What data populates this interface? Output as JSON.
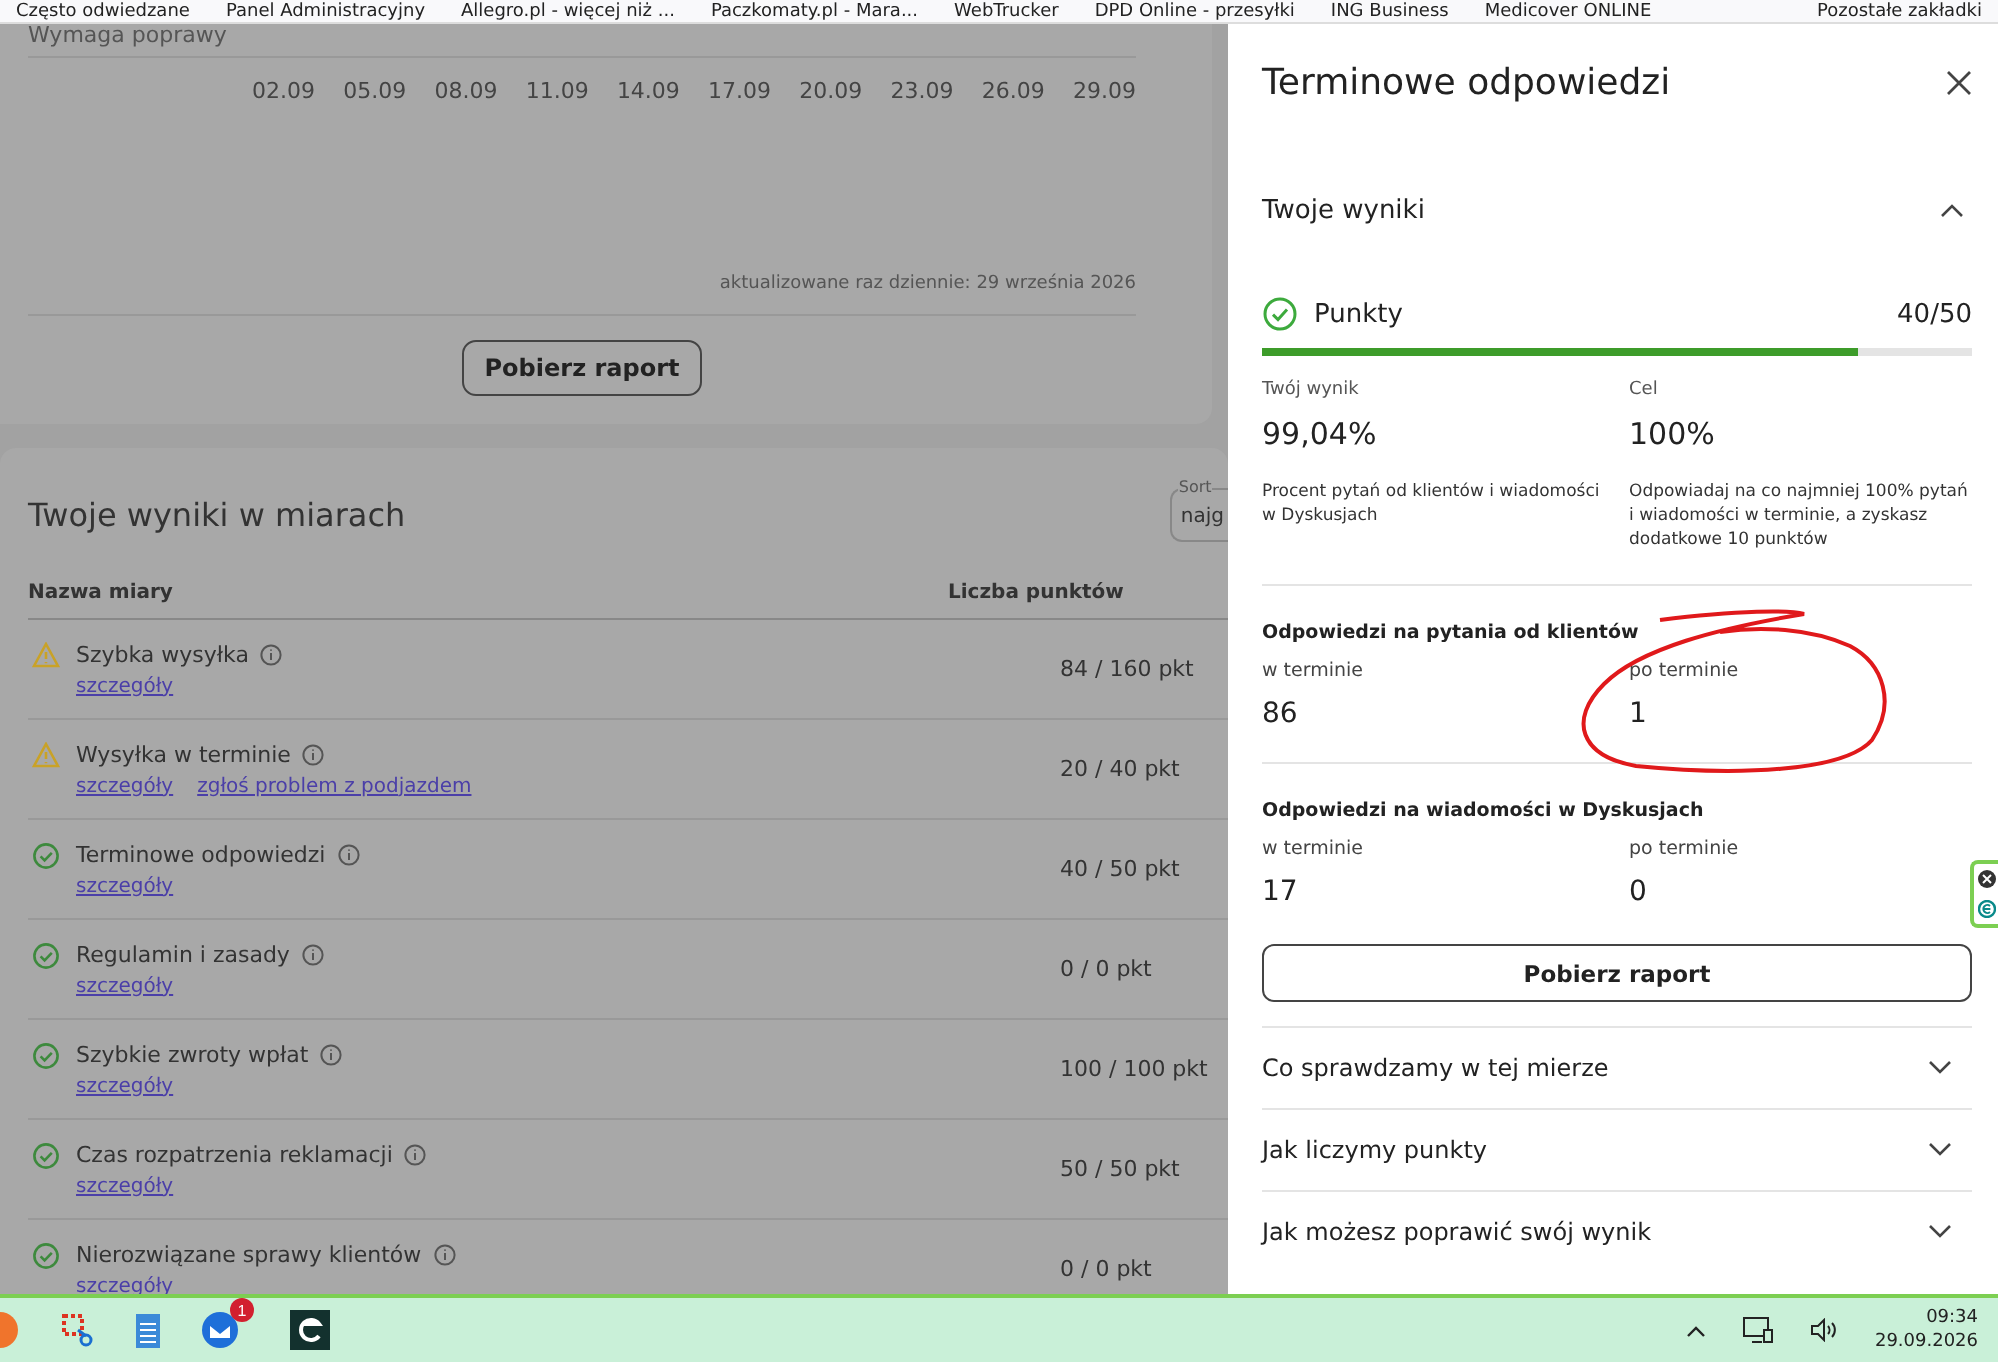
{
  "bookmarks": [
    "Często odwiedzane",
    "Panel Administracyjny",
    "Allegro.pl - więcej niż ...",
    "Paczkomaty.pl - Mara...",
    "WebTrucker",
    "DPD Online - przesyłki",
    "ING Business",
    "Medicover ONLINE"
  ],
  "bookmarks_other": "Pozostałe zakładki",
  "chart_card": {
    "legend": "Wymaga poprawy",
    "x_ticks": [
      "02.09",
      "05.09",
      "08.09",
      "11.09",
      "14.09",
      "17.09",
      "20.09",
      "23.09",
      "26.09",
      "29.09"
    ],
    "updated": "aktualizowane raz dziennie: 29 września 2026",
    "button": "Pobierz raport"
  },
  "measures": {
    "title": "Twoje wyniki w miarach",
    "sort": {
      "label": "Sort",
      "value": "najg"
    },
    "columns": [
      "Nazwa miary",
      "Liczba punktów"
    ],
    "rows": [
      {
        "kind": "warning",
        "name": "Szybka wysyłka",
        "links": [
          "szczegóły"
        ],
        "points": "84 / 160 pkt"
      },
      {
        "kind": "warning",
        "name": "Wysyłka w terminie",
        "links": [
          "szczegóły",
          "zgłoś problem z podjazdem"
        ],
        "points": "20 / 40 pkt"
      },
      {
        "kind": "ok",
        "name": "Terminowe odpowiedzi",
        "links": [
          "szczegóły"
        ],
        "points": "40 / 50 pkt"
      },
      {
        "kind": "ok",
        "name": "Regulamin i zasady",
        "links": [
          "szczegóły"
        ],
        "points": "0 / 0 pkt"
      },
      {
        "kind": "ok",
        "name": "Szybkie zwroty wpłat",
        "links": [
          "szczegóły"
        ],
        "points": "100 / 100 pkt"
      },
      {
        "kind": "ok",
        "name": "Czas rozpatrzenia reklamacji",
        "links": [
          "szczegóły"
        ],
        "points": "50 / 50 pkt"
      },
      {
        "kind": "ok",
        "name": "Nierozwiązane sprawy klientów",
        "links": [
          "szczegóły"
        ],
        "points": "0 / 0 pkt"
      }
    ]
  },
  "drawer": {
    "title": "Terminowe odpowiedzi",
    "results": {
      "title": "Twoje wyniki",
      "expanded": true,
      "points_label": "Punkty",
      "points_value": "40/50",
      "level": 0.84,
      "stats": [
        {
          "label": "Twój wynik",
          "value": "99,04%",
          "description": "Procent pytań od klientów i wiadomości w Dyskusjach"
        },
        {
          "label": "Cel",
          "value": "100%",
          "description": "Odpowiadaj na co najmniej 100% pytań i wiadomości w terminie, a zyskasz dodatkowe 10 punktów"
        }
      ]
    },
    "groups": [
      {
        "title": "Odpowiedzi na pytania od klientów",
        "items": [
          {
            "label": "w terminie",
            "value": "86"
          },
          {
            "label": "po terminie",
            "value": "1"
          }
        ]
      },
      {
        "title": "Odpowiedzi na wiadomości w Dyskusjach",
        "items": [
          {
            "label": "w terminie",
            "value": "17"
          },
          {
            "label": "po terminie",
            "value": "0"
          }
        ]
      }
    ],
    "button": "Pobierz raport",
    "accordion": [
      {
        "title": "Co sprawdzamy w tej mierze",
        "expanded": false
      },
      {
        "title": "Jak liczymy punkty",
        "expanded": false
      },
      {
        "title": "Jak możesz poprawić swój wynik",
        "expanded": false
      }
    ]
  },
  "taskbar": {
    "mail_badge": "1",
    "time": "09:34",
    "date": "29.09.2026"
  }
}
